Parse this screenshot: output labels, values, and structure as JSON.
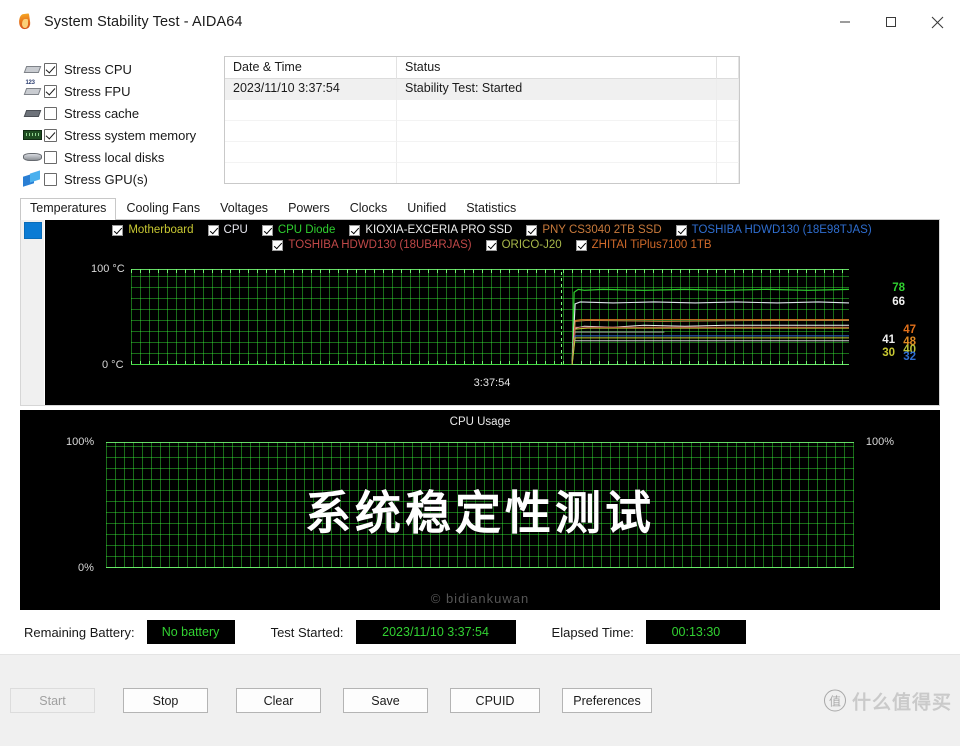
{
  "window": {
    "title": "System Stability Test - AIDA64",
    "icon": "flame-icon",
    "minimize_label": "─",
    "maximize_label": "□",
    "close_label": "✕"
  },
  "options": [
    {
      "label": "Stress CPU",
      "checked": true,
      "icon": "cpu-chip-icon"
    },
    {
      "label": "Stress FPU",
      "checked": true,
      "icon": "fpu-chip-icon"
    },
    {
      "label": "Stress cache",
      "checked": false,
      "icon": "cache-chip-icon"
    },
    {
      "label": "Stress system memory",
      "checked": true,
      "icon": "memory-module-icon"
    },
    {
      "label": "Stress local disks",
      "checked": false,
      "icon": "hard-disk-icon"
    },
    {
      "label": "Stress GPU(s)",
      "checked": false,
      "icon": "gpu-card-icon"
    }
  ],
  "log": {
    "columns": [
      "Date & Time",
      "Status"
    ],
    "rows": [
      {
        "datetime": "2023/11/10 3:37:54",
        "status": "Stability Test: Started"
      }
    ],
    "empty_row_count": 5
  },
  "tabs": [
    {
      "label": "Temperatures",
      "active": true
    },
    {
      "label": "Cooling Fans",
      "active": false
    },
    {
      "label": "Voltages",
      "active": false
    },
    {
      "label": "Powers",
      "active": false
    },
    {
      "label": "Clocks",
      "active": false
    },
    {
      "label": "Unified",
      "active": false
    },
    {
      "label": "Statistics",
      "active": false
    }
  ],
  "temperature_legend": {
    "line1": [
      {
        "label": "Motherboard",
        "color": "#c8c832",
        "checked": true
      },
      {
        "label": "CPU",
        "color": "#e8e8f0",
        "checked": true
      },
      {
        "label": "CPU Diode",
        "color": "#2fd02f",
        "checked": true
      },
      {
        "label": "KIOXIA-EXCERIA PRO SSD",
        "color": "#f0f0f0",
        "checked": true
      },
      {
        "label": "PNY CS3040 2TB SSD",
        "color": "#c97a3c",
        "checked": true
      },
      {
        "label": "TOSHIBA HDWD130 (18E98TJAS)",
        "color": "#2f6ed0",
        "checked": true
      }
    ],
    "line2": [
      {
        "label": "TOSHIBA HDWD130 (18UB4RJAS)",
        "color": "#c04848",
        "checked": true
      },
      {
        "label": "ORICO-J20",
        "color": "#a8b84a",
        "checked": true
      },
      {
        "label": "ZHITAI TiPlus7100 1TB",
        "color": "#d06a2a",
        "checked": true
      }
    ]
  },
  "chart_data": [
    {
      "type": "line",
      "title": "Temperatures",
      "ylabel": "",
      "ytick_top": "100 °C",
      "ytick_bottom": "0 °C",
      "ylim": [
        0,
        100
      ],
      "grid": true,
      "xlabel": "",
      "x_tick_label": "3:37:54",
      "legend_position": "top",
      "series": [
        {
          "name": "CPU Diode",
          "color": "#2fd02f",
          "value": 78,
          "value_label": "78"
        },
        {
          "name": "CPU",
          "color": "#e8e8f0",
          "value": 66,
          "value_label": "66"
        },
        {
          "name": "PNY CS3040 2TB SSD",
          "color": "#d06a2a",
          "value": 47,
          "value_label": "47"
        },
        {
          "name": "ZHITAI TiPlus7100 1TB",
          "color": "#d4741f",
          "value": 48,
          "value_label": "48"
        },
        {
          "name": "KIOXIA-EXCERIA PRO SSD",
          "color": "#f0f0f0",
          "value": 41,
          "value_label": "41"
        },
        {
          "name": "ORICO-J20",
          "color": "#c8c832",
          "value": 40,
          "value_label": "40"
        },
        {
          "name": "Motherboard",
          "color": "#c8c832",
          "value": 30,
          "value_label": "30"
        },
        {
          "name": "TOSHIBA HDWD130 (18E98TJAS)",
          "color": "#2f6ed0",
          "value": 32,
          "value_label": "32"
        }
      ]
    },
    {
      "type": "line",
      "title": "CPU Usage",
      "ytick_top_left": "100%",
      "ytick_top_right": "100%",
      "ytick_bottom": "0%",
      "ylim": [
        0,
        100
      ],
      "grid": true,
      "series": [
        {
          "name": "CPU Usage",
          "color": "#2fd02f",
          "value": 100
        }
      ]
    }
  ],
  "cpu_panel": {
    "overlay_text": "系统稳定性测试",
    "watermark": "© bidiankuwan"
  },
  "status": {
    "battery_label": "Remaining Battery:",
    "battery_value": "No battery",
    "started_label": "Test Started:",
    "started_value": "2023/11/10 3:37:54",
    "elapsed_label": "Elapsed Time:",
    "elapsed_value": "00:13:30",
    "value_color": "#32d132"
  },
  "buttons": [
    {
      "label": "Start",
      "disabled": true
    },
    {
      "label": "Stop",
      "disabled": false
    },
    {
      "label": "Clear",
      "disabled": false
    },
    {
      "label": "Save",
      "disabled": false
    },
    {
      "label": "CPUID",
      "disabled": false
    },
    {
      "label": "Preferences",
      "disabled": false
    }
  ],
  "statusbar_watermark": {
    "mark": "值",
    "text": "什么值得买"
  }
}
